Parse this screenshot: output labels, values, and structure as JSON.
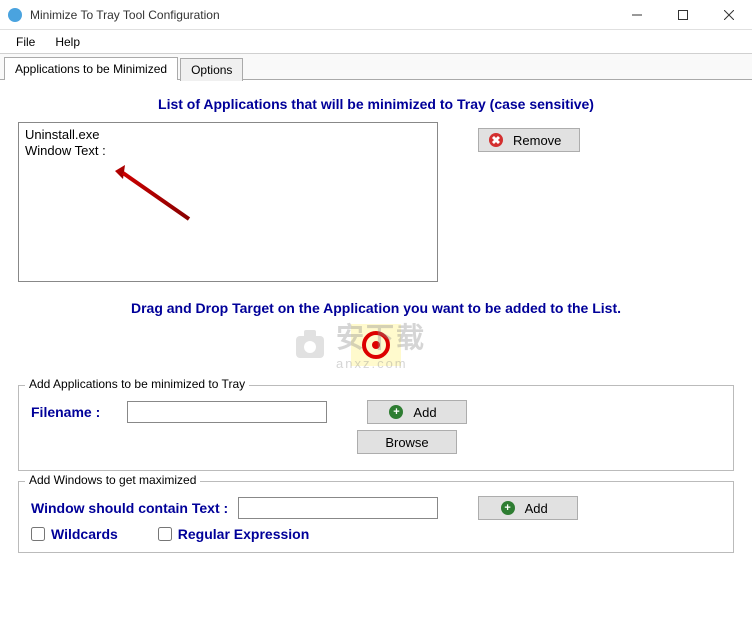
{
  "window": {
    "title": "Minimize To Tray Tool Configuration"
  },
  "menu": {
    "file": "File",
    "help": "Help"
  },
  "tabs": {
    "applications": "Applications to be Minimized",
    "options": "Options"
  },
  "main": {
    "list_title": "List of Applications that will be minimized to Tray (case sensitive)",
    "list": {
      "line1": "Uninstall.exe",
      "line2": "Window Text :"
    },
    "remove_label": "Remove",
    "drag_text": "Drag and Drop Target on the Application you want to be added to the List."
  },
  "group_add": {
    "title": "Add Applications to be minimized to Tray",
    "filename_label": "Filename :",
    "filename_value": "",
    "add_label": "Add",
    "browse_label": "Browse"
  },
  "group_max": {
    "title": "Add Windows to get maximized",
    "wintext_label": "Window should contain Text :",
    "wintext_value": "",
    "add_label": "Add",
    "wildcards_label": "Wildcards",
    "regex_label": "Regular Expression"
  },
  "watermark": {
    "text": "安下载",
    "url": "anxz.com"
  }
}
